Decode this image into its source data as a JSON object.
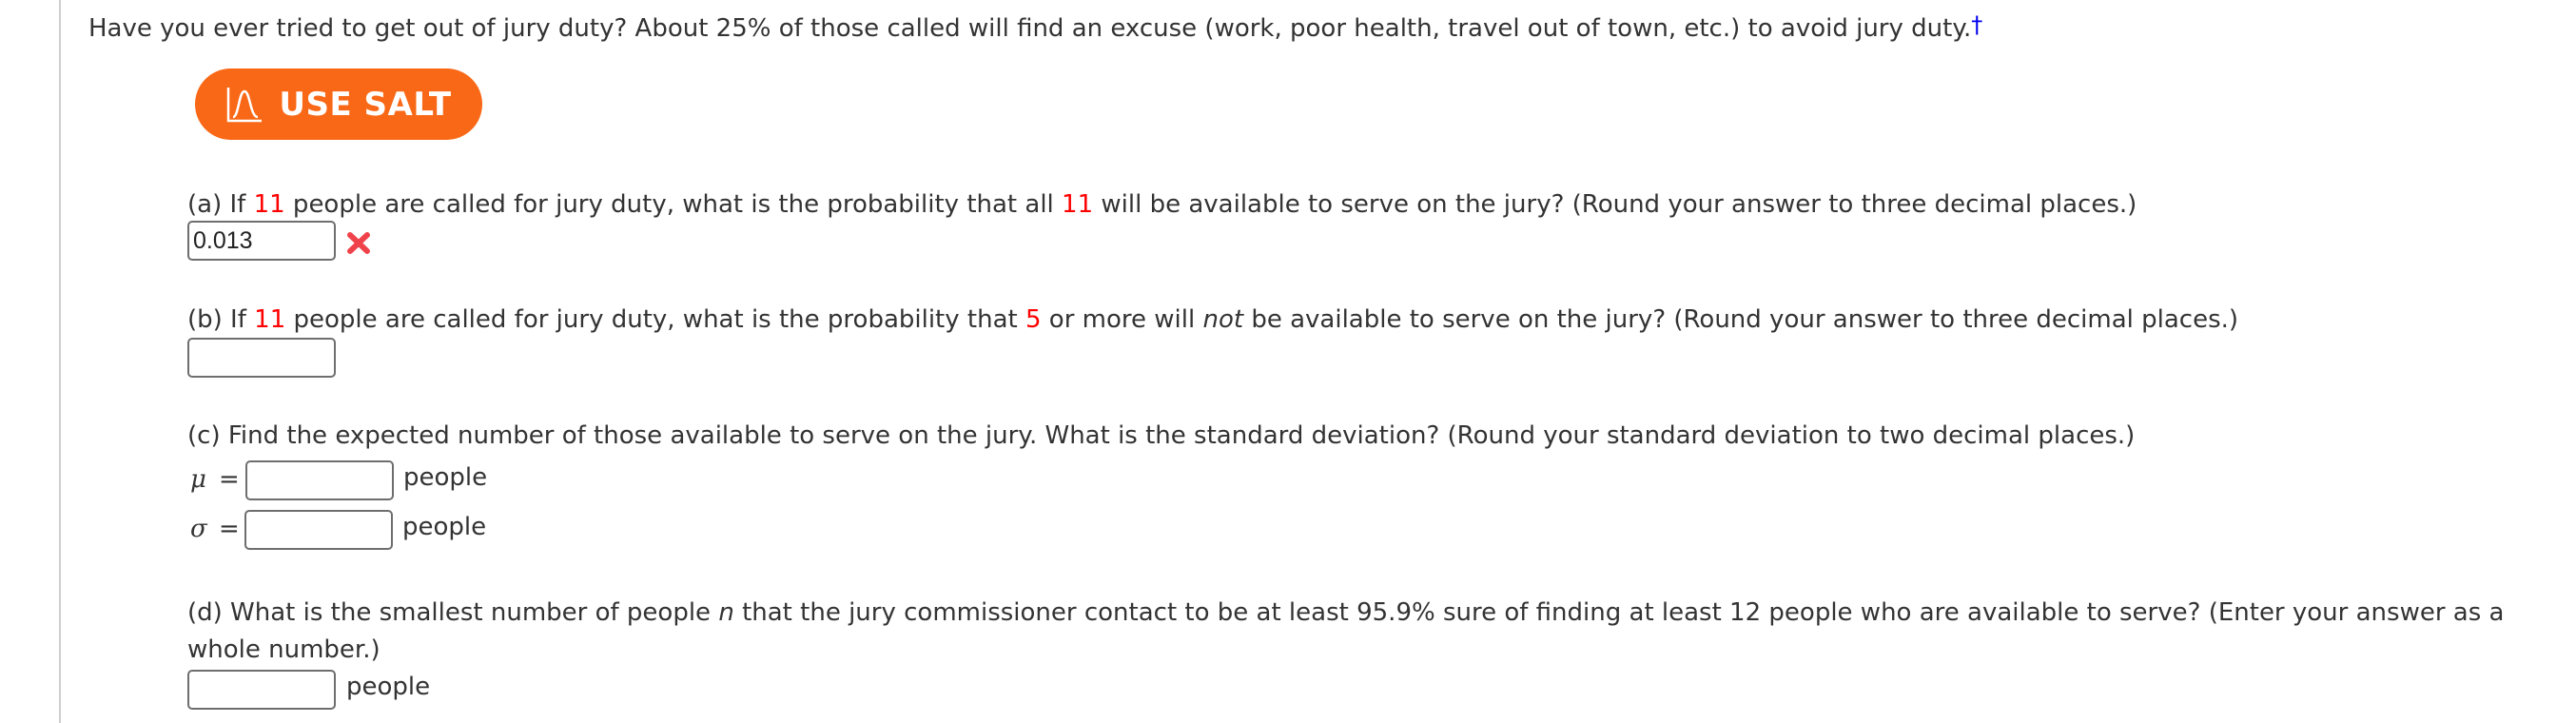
{
  "intro": {
    "text": "Have you ever tried to get out of jury duty? About 25% of those called will find an excuse (work, poor health, travel out of town, etc.) to avoid jury duty.",
    "footnote_marker": "†"
  },
  "salt_button": {
    "label": "USE SALT",
    "icon": "normal-curve-icon",
    "color": "#f96816"
  },
  "parts": {
    "a": {
      "pre": "(a) If ",
      "n1": "11",
      "mid": " people are called for jury duty, what is the probability that all ",
      "n2": "11",
      "post": " will be available to serve on the jury? (Round your answer to three decimal places.)",
      "answer_value": "0.013",
      "status": "incorrect",
      "status_icon": "x-mark-icon",
      "status_color": "#f0424a"
    },
    "b": {
      "pre": "(b) If ",
      "n1": "11",
      "mid": " people are called for jury duty, what is the probability that ",
      "n2": "5",
      "mid2": " or more will ",
      "emph": "not",
      "post": " be available to serve on the jury? (Round your answer to three decimal places.)",
      "answer_value": ""
    },
    "c": {
      "text": "(c) Find the expected number of those available to serve on the jury. What is the standard deviation? (Round your standard deviation to two decimal places.)",
      "mu_symbol": "μ",
      "sigma_symbol": "σ",
      "equals": "=",
      "mu_value": "",
      "sigma_value": "",
      "unit": "people"
    },
    "d": {
      "pre": "(d) What is the smallest number of people ",
      "var": "n",
      "post": " that the jury commissioner contact to be at least 95.9% sure of finding at least 12 people who are available to serve? (Enter your answer as a",
      "line2": "whole number.)",
      "answer_value": "",
      "unit": "people"
    }
  },
  "colors": {
    "highlight_number": "#ff0000",
    "link": "#0000ee",
    "text": "#333333"
  }
}
